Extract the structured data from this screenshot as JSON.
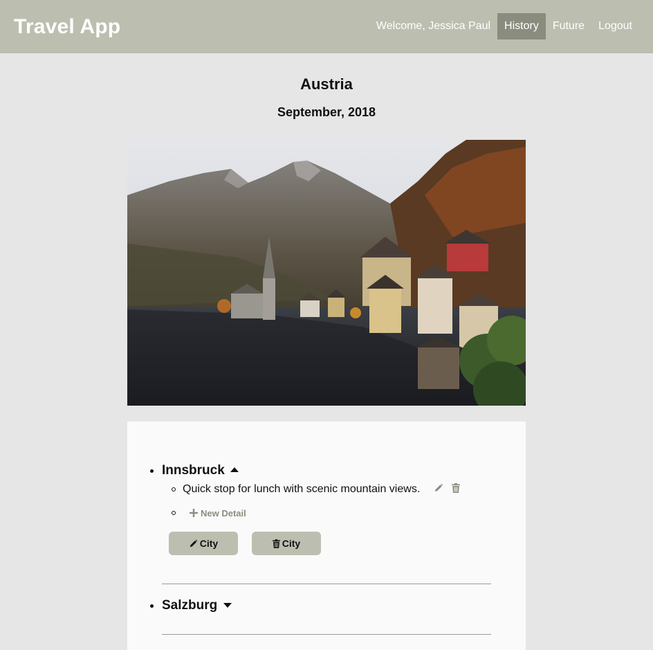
{
  "nav": {
    "brand": "Travel App",
    "welcome": "Welcome, Jessica Paul",
    "links": [
      "History",
      "Future",
      "Logout"
    ],
    "active": "History"
  },
  "trip": {
    "country": "Austria",
    "date": "September, 2018"
  },
  "photo": {
    "subject": "lakeside alpine village with mountains"
  },
  "cities": [
    {
      "name": "Innsbruck",
      "expanded": true,
      "details": [
        "Quick stop for lunch with scenic mountain views."
      ],
      "new_detail_label": "New Detail",
      "edit_button_label": "City",
      "delete_button_label": "City"
    },
    {
      "name": "Salzburg",
      "expanded": false
    }
  ],
  "icons": {
    "edit": "pencil-icon",
    "delete": "trash-icon",
    "add": "plus-icon",
    "expanded": "caret-up-icon",
    "collapsed": "caret-down-icon"
  },
  "colors": {
    "navbar": "#bcbfb0",
    "active_link": "#8a8d7e",
    "page_background": "#e6e6e6",
    "card_background": "#fafafa",
    "button": "#bcbfb0",
    "muted_icon": "#8a8d7e"
  }
}
